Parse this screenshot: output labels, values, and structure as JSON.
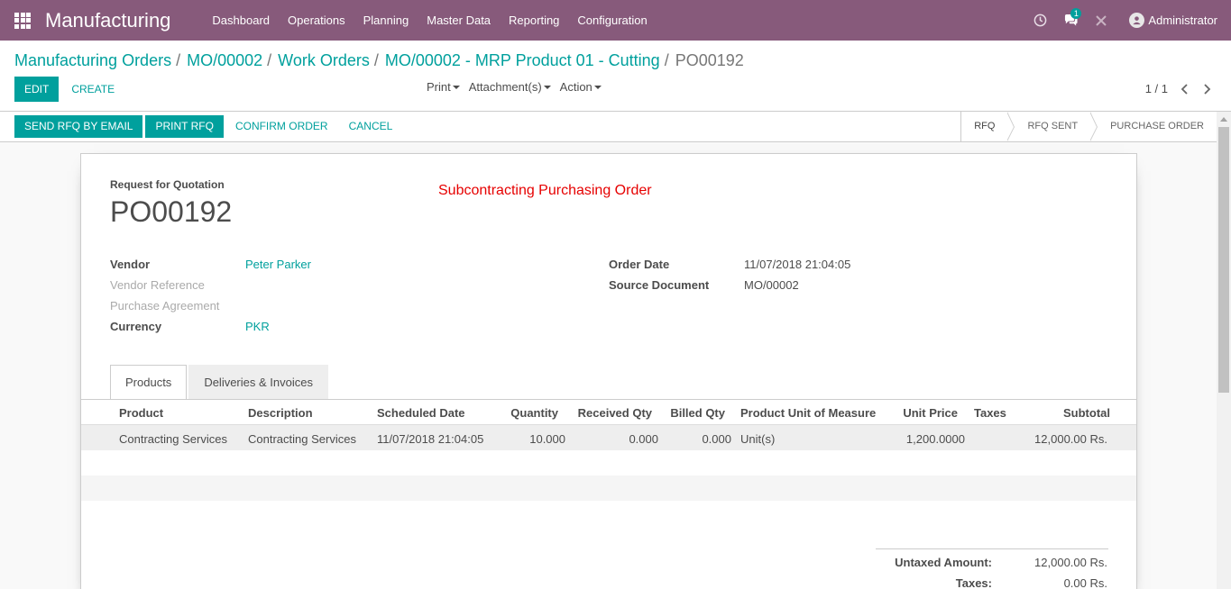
{
  "navbar": {
    "app_title": "Manufacturing",
    "menu": [
      "Dashboard",
      "Operations",
      "Planning",
      "Master Data",
      "Reporting",
      "Configuration"
    ],
    "icons": [
      "clock-icon",
      "chat-icon",
      "tools-icon"
    ],
    "chat_count": "1",
    "user_name": "Administrator"
  },
  "breadcrumb": {
    "items": [
      "Manufacturing Orders",
      "MO/00002",
      "Work Orders",
      "MO/00002 - MRP Product 01 - Cutting"
    ],
    "current": "PO00192"
  },
  "control": {
    "edit_label": "Edit",
    "create_label": "Create",
    "print_label": "Print",
    "attachments_label": "Attachment(s)",
    "action_label": "Action",
    "pager": "1 / 1"
  },
  "statusbar": {
    "send_rfq": "Send RFQ by Email",
    "print_rfq": "Print RFQ",
    "confirm": "Confirm Order",
    "cancel": "Cancel",
    "stages": [
      "RFQ",
      "RFQ Sent",
      "Purchase Order"
    ],
    "active_stage": "RFQ"
  },
  "form": {
    "doc_label": "Request for Quotation",
    "doc_name": "PO00192",
    "note": "Subcontracting Purchasing Order",
    "vendor_label": "Vendor",
    "vendor": "Peter Parker",
    "vendor_ref_label": "Vendor Reference",
    "agreement_label": "Purchase Agreement",
    "currency_label": "Currency",
    "currency": "PKR",
    "order_date_label": "Order Date",
    "order_date": "11/07/2018 21:04:05",
    "source_label": "Source Document",
    "source": "MO/00002"
  },
  "tabs": [
    "Products",
    "Deliveries & Invoices"
  ],
  "table": {
    "columns": [
      "Product",
      "Description",
      "Scheduled Date",
      "Quantity",
      "Received Qty",
      "Billed Qty",
      "Product Unit of Measure",
      "Unit Price",
      "Taxes",
      "Subtotal"
    ],
    "rows": [
      {
        "product": "Contracting Services",
        "description": "Contracting Services",
        "scheduled_date": "11/07/2018 21:04:05",
        "quantity": "10.000",
        "received": "0.000",
        "billed": "0.000",
        "uom": "Unit(s)",
        "unit_price": "1,200.0000",
        "taxes": "",
        "subtotal": "12,000.00 Rs."
      }
    ]
  },
  "totals": {
    "untaxed_label": "Untaxed Amount:",
    "untaxed": "12,000.00 Rs.",
    "taxes_label": "Taxes:",
    "taxes": "0.00 Rs."
  },
  "colors": {
    "navbar": "#875a7b",
    "primary": "#00a09d",
    "note": "#e60000"
  }
}
